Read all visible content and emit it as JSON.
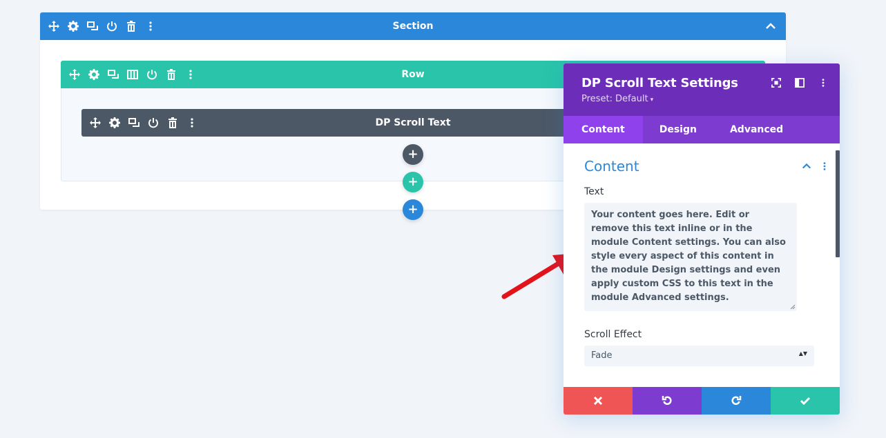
{
  "section": {
    "title": "Section"
  },
  "row": {
    "title": "Row"
  },
  "module": {
    "title": "DP Scroll Text"
  },
  "add_buttons": {
    "symbol": "+"
  },
  "modal": {
    "title": "DP Scroll Text Settings",
    "preset": "Preset: Default",
    "preset_caret": "▾",
    "tabs": [
      {
        "label": "Content",
        "active": true
      },
      {
        "label": "Design",
        "active": false
      },
      {
        "label": "Advanced",
        "active": false
      }
    ],
    "group_title": "Content",
    "text_label": "Text",
    "text_value": "Your content goes here. Edit or remove this text inline or in the module Content settings. You can also style every aspect of this content in the module Design settings and even apply custom CSS to this text in the module Advanced settings.",
    "scroll_effect_label": "Scroll Effect",
    "scroll_effect_value": "Fade",
    "select_arrows": "▲▼"
  },
  "colors": {
    "section": "#2b87da",
    "row": "#29c4a9",
    "module": "#4c5866",
    "modal_header": "#6c2eb9",
    "modal_tabs": "#7e3bd0",
    "modal_tab_active": "#8f42ec",
    "cancel": "#ef5555",
    "undo": "#7e3bd0",
    "redo": "#2b87da",
    "save": "#29c4a9",
    "annotation_arrow": "#e3131b"
  },
  "icons": {
    "bar_icons": [
      "move-icon",
      "gear-icon",
      "duplicate-icon",
      "power-icon",
      "trash-icon",
      "more-icon"
    ],
    "row_extra": "columns-icon",
    "header_icons": [
      "expand-icon",
      "sidebar-icon",
      "more-icon"
    ],
    "footer": [
      "close-icon",
      "undo-icon",
      "redo-icon",
      "check-icon"
    ]
  }
}
